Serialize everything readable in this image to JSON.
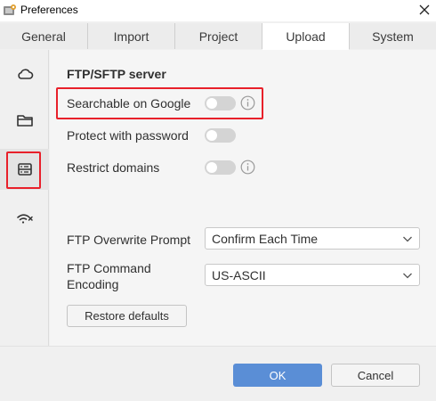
{
  "window": {
    "title": "Preferences",
    "app_icon": "preferences-app-icon",
    "close_icon": "close-icon"
  },
  "tabs": [
    {
      "label": "General",
      "active": false
    },
    {
      "label": "Import",
      "active": false
    },
    {
      "label": "Project",
      "active": false
    },
    {
      "label": "Upload",
      "active": true
    },
    {
      "label": "System",
      "active": false
    }
  ],
  "sidebar": {
    "items": [
      {
        "icon": "cloud-icon",
        "selected": false
      },
      {
        "icon": "folder-icon",
        "selected": false
      },
      {
        "icon": "server-icon",
        "selected": true
      },
      {
        "icon": "wifi-off-icon",
        "selected": false
      }
    ]
  },
  "main": {
    "section_title": "FTP/SFTP server",
    "options": [
      {
        "label": "Searchable on Google",
        "enabled": false,
        "has_info": true
      },
      {
        "label": "Protect with password",
        "enabled": false,
        "has_info": false
      },
      {
        "label": "Restrict domains",
        "enabled": false,
        "has_info": true
      }
    ],
    "ftp_overwrite": {
      "label": "FTP Overwrite Prompt",
      "value": "Confirm Each Time"
    },
    "ftp_encoding": {
      "label_line1": "FTP Command",
      "label_line2": "Encoding",
      "value": "US-ASCII"
    },
    "restore_label": "Restore defaults"
  },
  "footer": {
    "ok_label": "OK",
    "cancel_label": "Cancel"
  },
  "colors": {
    "accent": "#5a8ed6",
    "highlight": "#e8202a",
    "toggle_off": "#d4d4d4"
  }
}
